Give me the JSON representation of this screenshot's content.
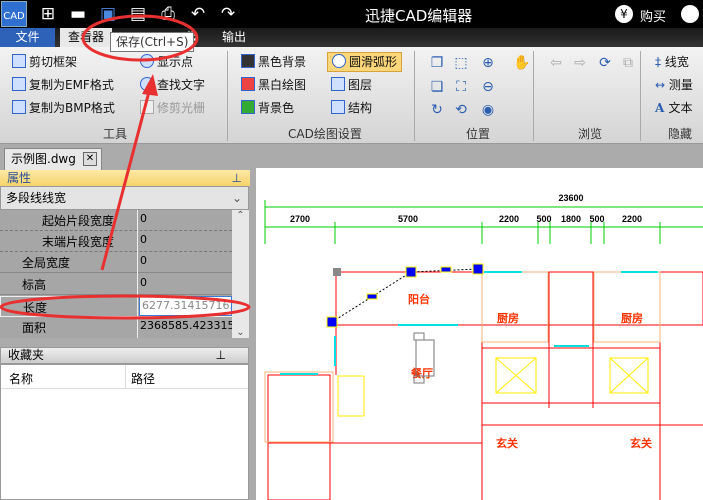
{
  "titlebar": {
    "logo": "CAD",
    "title": "迅捷CAD编辑器",
    "buy": "购买",
    "icons": [
      "new-file-icon",
      "open-folder-icon",
      "save-icon",
      "save-pdf-icon",
      "print-icon",
      "undo-icon",
      "redo-icon"
    ]
  },
  "menu": {
    "file": "文件",
    "viewer": "查看器",
    "hidden_tab": "级",
    "output": "输出"
  },
  "tooltip": "保存(Ctrl+S)",
  "ribbon": {
    "tools": {
      "items": [
        "剪切框架",
        "复制为EMF格式",
        "复制为BMP格式",
        "显示点",
        "查找文字",
        "修剪光栅"
      ],
      "label": "工具"
    },
    "cad": {
      "items": [
        "黑色背景",
        "黑白绘图",
        "背景色",
        "圆滑弧形",
        "图层",
        "结构"
      ],
      "label": "CAD绘图设置"
    },
    "position": {
      "label": "位置"
    },
    "browse": {
      "label": "浏览"
    },
    "hide": {
      "items": [
        "线宽",
        "测量",
        "文本"
      ],
      "label": "隐藏"
    }
  },
  "doc_tab": "示例图.dwg",
  "properties": {
    "title": "属性",
    "selected": "多段线线宽",
    "rows": [
      {
        "key": "起始片段宽度",
        "value": "0"
      },
      {
        "key": "末端片段宽度",
        "value": "0"
      },
      {
        "key": "全局宽度",
        "value": "0"
      },
      {
        "key": "标高",
        "value": "0"
      },
      {
        "key": "长度",
        "value": "6277.314157163"
      },
      {
        "key": "面积",
        "value": "2368585.42331567"
      }
    ]
  },
  "favorites": {
    "title": "收藏夹",
    "col_name": "名称",
    "col_path": "路径"
  },
  "drawing": {
    "dims_total": "23600",
    "dims": [
      "2700",
      "5700",
      "2200",
      "500",
      "1800",
      "500",
      "2200"
    ],
    "rooms": [
      "阳台",
      "厨房",
      "厨房",
      "餐厅",
      "玄关",
      "玄关"
    ]
  },
  "colors": {
    "accent": "#2d62b8",
    "annotation": "#e83030",
    "wall": "#ff0000",
    "dim": "#00cc00"
  }
}
